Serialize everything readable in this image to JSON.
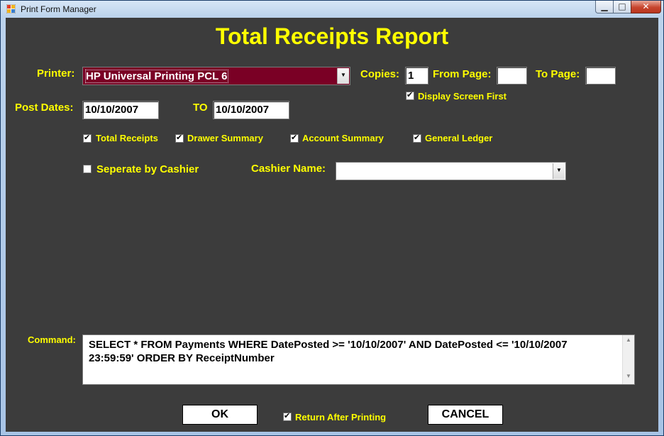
{
  "window": {
    "title": "Print Form Manager"
  },
  "report": {
    "title": "Total Receipts Report"
  },
  "printer": {
    "label": "Printer:",
    "value": "HP Universal Printing PCL 6"
  },
  "copies": {
    "label": "Copies:",
    "value": "1"
  },
  "from_page": {
    "label": "From Page:",
    "value": ""
  },
  "to_page": {
    "label": "To Page:",
    "value": ""
  },
  "display_screen_first": {
    "label": "Display Screen First",
    "checked": true
  },
  "post_dates": {
    "label": "Post Dates:",
    "from": "10/10/2007",
    "to_label": "TO",
    "to": "10/10/2007"
  },
  "options": [
    {
      "label": "Total Receipts",
      "checked": true
    },
    {
      "label": "Drawer Summary",
      "checked": true
    },
    {
      "label": "Account Summary",
      "checked": true
    },
    {
      "label": "General Ledger",
      "checked": true
    }
  ],
  "separate_by_cashier": {
    "label": "Seperate by Cashier",
    "checked": false
  },
  "cashier_name": {
    "label": "Cashier Name:",
    "value": ""
  },
  "command": {
    "label": "Command:",
    "value": "SELECT * FROM Payments WHERE DatePosted >= '10/10/2007' AND DatePosted <= '10/10/2007 23:59:59'  ORDER BY ReceiptNumber"
  },
  "buttons": {
    "ok": "OK",
    "cancel": "CANCEL"
  },
  "return_after_printing": {
    "label": "Return After Printing",
    "checked": true
  },
  "colors": {
    "background": "#3c3c3c",
    "label": "#ffff00",
    "printer_field": "#7a0025"
  }
}
